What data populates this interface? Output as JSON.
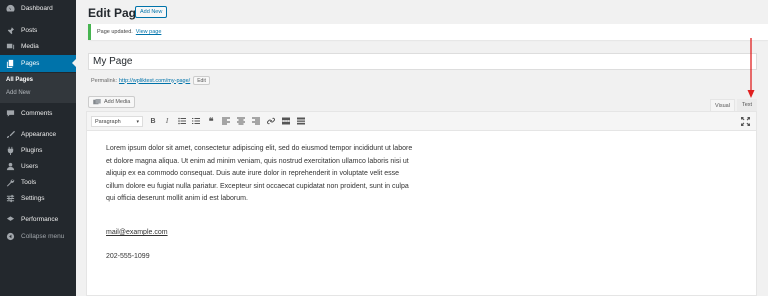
{
  "sidebar": {
    "items": [
      {
        "label": "Dashboard",
        "icon": "dashboard-icon"
      },
      {
        "label": "Posts",
        "icon": "pin-icon"
      },
      {
        "label": "Media",
        "icon": "media-icon"
      },
      {
        "label": "Pages",
        "icon": "pages-icon"
      },
      {
        "label": "Comments",
        "icon": "comment-icon"
      },
      {
        "label": "Appearance",
        "icon": "brush-icon"
      },
      {
        "label": "Plugins",
        "icon": "plugin-icon"
      },
      {
        "label": "Users",
        "icon": "users-icon"
      },
      {
        "label": "Tools",
        "icon": "wrench-icon"
      },
      {
        "label": "Settings",
        "icon": "settings-icon"
      },
      {
        "label": "Performance",
        "icon": "performance-icon"
      },
      {
        "label": "Collapse menu",
        "icon": "collapse-icon"
      }
    ],
    "submenu": [
      "All Pages",
      "Add New"
    ],
    "active_color": "#0073aa"
  },
  "header": {
    "title": "Edit Page",
    "add_new_label": "Add New"
  },
  "notice": {
    "text": "Page updated.",
    "link": "View page",
    "border_color": "#46b450"
  },
  "editor": {
    "title_value": "My Page",
    "permalink_label": "Permalink:",
    "permalink_url": "http://wpliktest.com/my-page/",
    "edit_label": "Edit",
    "add_media_label": "Add Media",
    "tab_visual": "Visual",
    "tab_text": "Text",
    "format_value": "Paragraph",
    "body_text": "Lorem ipsum dolor sit amet, consectetur adipiscing elit, sed do eiusmod tempor incididunt ut labore et dolore magna aliqua. Ut enim ad minim veniam, quis nostrud exercitation ullamco laboris nisi ut aliquip ex ea commodo consequat. Duis aute irure dolor in reprehenderit in voluptate velit esse cillum dolore eu fugiat nulla pariatur. Excepteur sint occaecat cupidatat non proident, sunt in culpa qui officia deserunt mollit anim id est laborum.",
    "email": "mail@example.com",
    "phone": "202-555-1099"
  },
  "annotation": {
    "arrow_color": "#e02020"
  }
}
